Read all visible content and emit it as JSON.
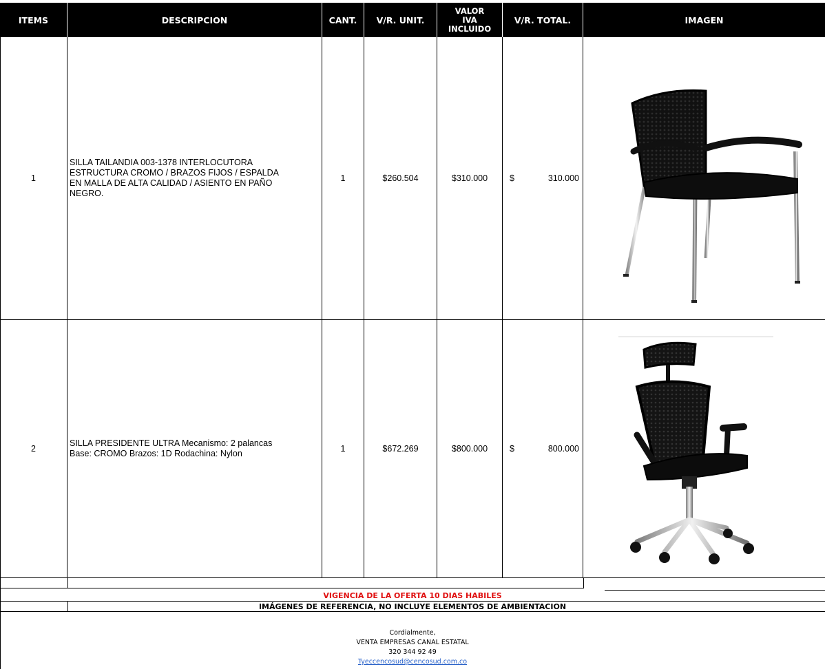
{
  "headers": {
    "items": "ITEMS",
    "descripcion": "DESCRIPCION",
    "cant": "CANT.",
    "vr_unit": "V/R. UNIT.",
    "valor_l1": "VALOR",
    "valor_l2": "IVA",
    "valor_l3": "INCLUIDO",
    "vr_total": "V/R. TOTAL.",
    "imagen": "IMAGEN"
  },
  "rows": [
    {
      "item": "1",
      "description": "SILLA TAILANDIA 003-1378 INTERLOCUTORA\n ESTRUCTURA CROMO / BRAZOS FIJOS / ESPALDA\nEN MALLA DE ALTA CALIDAD / ASIENTO EN PAÑO\nNEGRO.",
      "qty": "1",
      "unit_price": "$260.504",
      "price_iva": "$310.000",
      "total_symbol": "$",
      "total_value": "310.000",
      "image_icon": "visitor-chair-icon"
    },
    {
      "item": "2",
      "description": "SILLA PRESIDENTE ULTRA Mecanismo: 2 palancas\nBase: CROMO Brazos: 1D Rodachina: Nylon",
      "qty": "1",
      "unit_price": "$672.269",
      "price_iva": "$800.000",
      "total_symbol": "$",
      "total_value": "800.000",
      "image_icon": "executive-office-chair-icon"
    }
  ],
  "notes": {
    "validity": "VIGENCIA DE LA OFERTA 10 DIAS HABILES",
    "images_disclaimer": "IMÁGENES DE REFERENCIA, NO INCLUYE ELEMENTOS DE AMBIENTACION"
  },
  "signature": {
    "closing": "Cordialmente,",
    "company": "VENTA EMPRESAS CANAL ESTATAL",
    "phone": "320 344 92 49",
    "email": "Tyeccencosud@cencosud.com.co"
  },
  "colors": {
    "header_bg": "#000000",
    "header_text": "#ffffff",
    "validity_text": "#e01010",
    "link_text": "#2a62c9"
  }
}
